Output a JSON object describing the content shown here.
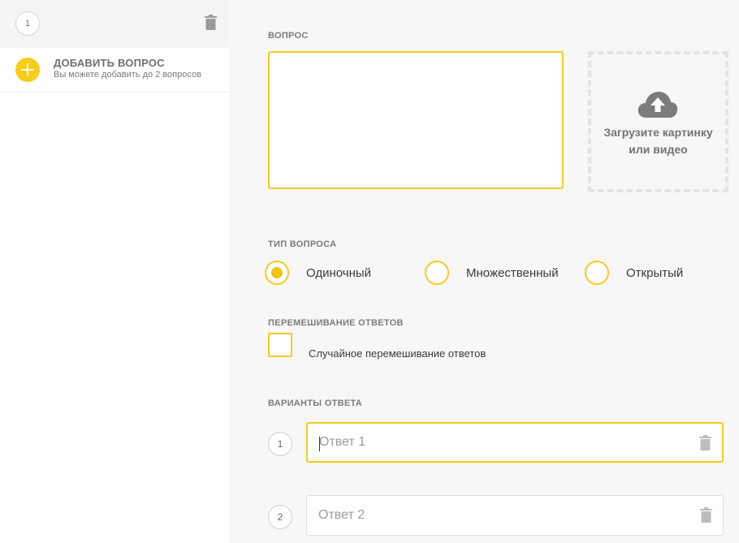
{
  "sidebar": {
    "question_number": "1",
    "add_title": "ДОБАВИТЬ ВОПРОС",
    "add_subtitle": "Вы можете добавить до 2 вопросов"
  },
  "question": {
    "label": "ВОПРОС",
    "value": "",
    "upload_text": "Загрузите картинку\nили видео"
  },
  "type": {
    "label": "ТИП ВОПРОСА",
    "options": [
      {
        "label": "Одиночный",
        "checked": true
      },
      {
        "label": "Множественный",
        "checked": false
      },
      {
        "label": "Открытый",
        "checked": false
      }
    ]
  },
  "shuffle": {
    "label": "ПЕРЕМЕШИВАНИЕ ОТВЕТОВ",
    "checkbox_label": "Случайное перемешивание ответов",
    "checked": false
  },
  "answers": {
    "label": "ВАРИАНТЫ ОТВЕТА",
    "items": [
      {
        "number": "1",
        "placeholder": "Ответ 1",
        "value": ""
      },
      {
        "number": "2",
        "placeholder": "Ответ 2",
        "value": ""
      }
    ]
  },
  "colors": {
    "accent": "#f4cb1e",
    "sidebar_bg": "#ffffff",
    "main_bg": "#f7f7f7"
  },
  "icons": [
    "trash-icon",
    "plus-icon",
    "cloud-upload-icon"
  ]
}
